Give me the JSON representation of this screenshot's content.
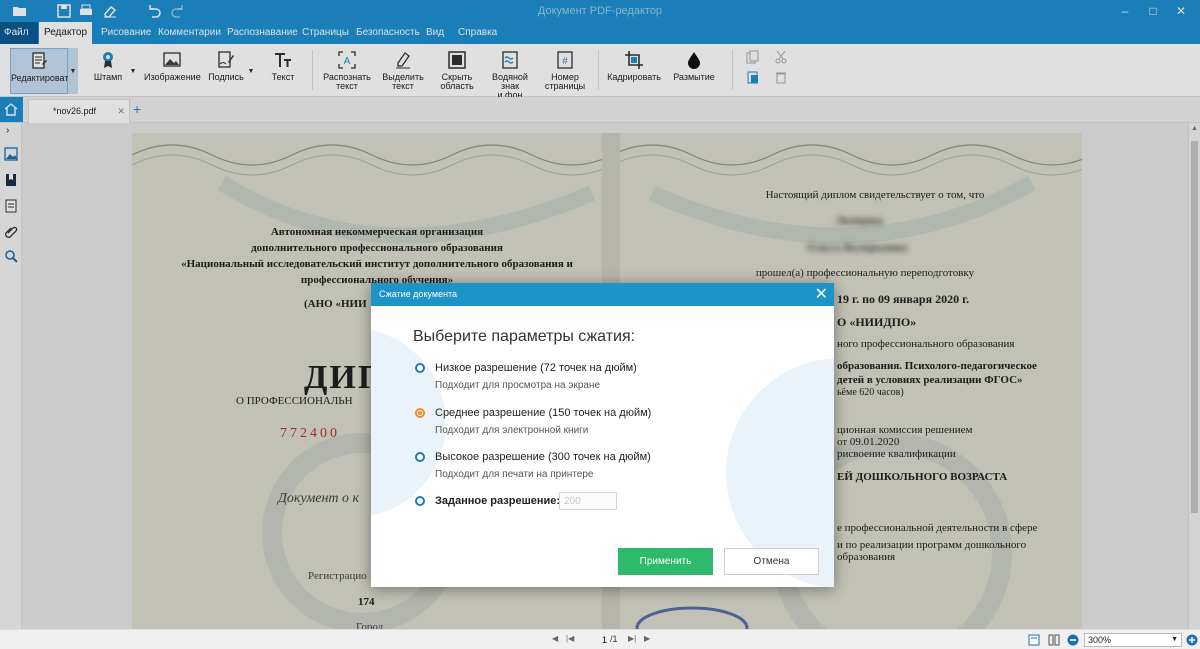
{
  "window": {
    "title": "Документ PDF-редактор"
  },
  "menu": {
    "file_label": "Файл",
    "tabs": [
      "Редактор",
      "Рисование",
      "Комментарии",
      "Распознавание",
      "Страницы",
      "Безопасность",
      "Вид",
      "Справка"
    ]
  },
  "ribbon": {
    "edit": "Редактировать",
    "stamp": "Штамп",
    "image": "Изображение",
    "signature": "Подпись",
    "text": "Текст",
    "recognize_1": "Распознать",
    "recognize_2": "текст",
    "select_1": "Выделить",
    "select_2": "текст",
    "hide_1": "Скрыть",
    "hide_2": "область",
    "watermark_1": "Водяной знак",
    "watermark_2": "и фон",
    "pagenum_1": "Номер",
    "pagenum_2": "страницы",
    "crop": "Кадрировать",
    "blur": "Размытие"
  },
  "tabs": {
    "doc_name": "*nov26.pdf"
  },
  "document": {
    "l1": "Автономная некоммерческая организация",
    "l2": "дополнительного профессионального образования",
    "l3": "«Национальный исследовательский институт дополнительного образования и",
    "l4": "профессионального обучения»",
    "l5": "(АНО «НИИ",
    "big": "ДИП",
    "sub": "О ПРОФЕССИОНАЛЬН",
    "serial": "772400",
    "italic": "Документ о к",
    "reg": "Регистрацио",
    "regnum": "174",
    "city": "Город",
    "r1": "Настоящий диплом свидетельствует о том, что",
    "r2": "Ломцова",
    "r3": "Ольга Валерьевна",
    "r4": "прошел(а) профессиональную переподготовку",
    "r5": "19 г. по 09 января 2020 г.",
    "r6": "О «НИИДПО»",
    "r7": "ного профессионального образования",
    "r8": "образования. Психолого-педагогическое",
    "r9": "детей в условиях реализации ФГОС»",
    "r10": "ьёме 620 часов)",
    "r11": "ционная комиссия решением",
    "r12": "от 09.01.2020",
    "r13": "рисвоение квалификации",
    "r14": "ЕЙ ДОШКОЛЬНОГО ВОЗРАСТА",
    "r15": "е профессиональной деятельности в сфере",
    "r16": "и по реализации программ дошкольного",
    "r17": "образования"
  },
  "dialog": {
    "title": "Сжатие документа",
    "heading": "Выберите параметры сжатия:",
    "options": [
      {
        "title": "Низкое разрешение (72 точек на дюйм)",
        "subtitle": "Подходит для просмотра на экране"
      },
      {
        "title": "Среднее разрешение (150 точек на дюйм)",
        "subtitle": "Подходит для электронной книги"
      },
      {
        "title": "Высокое разрешение (300 точек на дюйм)",
        "subtitle": "Подходит для печати на принтере"
      },
      {
        "title": "Заданное разрешение:",
        "subtitle": ""
      }
    ],
    "selected_index": 1,
    "custom_value": "200",
    "apply_label": "Применить",
    "cancel_label": "Отмена"
  },
  "status": {
    "page_current": "1",
    "page_total": "/1",
    "zoom": "300%"
  },
  "colors": {
    "accent": "#1e90d2",
    "dialog_header": "#1d93c8",
    "apply": "#2dba6c",
    "radio_selected": "#f08a2b"
  }
}
